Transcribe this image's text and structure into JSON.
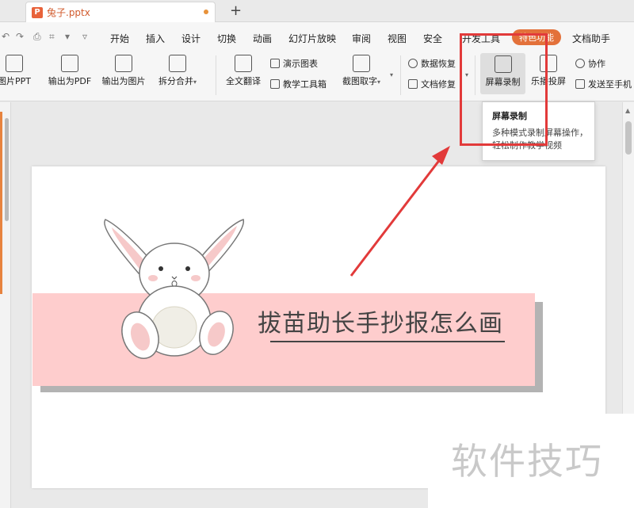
{
  "tab": {
    "icon": "P",
    "title": "兔子.pptx"
  },
  "menu": {
    "items": [
      "开始",
      "插入",
      "设计",
      "切换",
      "动画",
      "幻灯片放映",
      "审阅",
      "视图",
      "安全",
      "开发工具"
    ],
    "special": "特色功能",
    "docs": "文档助手"
  },
  "ribbon": {
    "img_ppt": "图片PPT",
    "pdf": "输出为PDF",
    "img_out": "输出为图片",
    "split": "拆分合并",
    "translate": "全文翻译",
    "demo_chart": "演示图表",
    "teach_tools": "教学工具箱",
    "screenshot_text": "截图取字",
    "data_recovery": "数据恢复",
    "doc_repair": "文档修复",
    "screen_record": "屏幕录制",
    "cast": "乐播投屏",
    "collab": "协作",
    "send_phone": "发送至手机"
  },
  "tooltip": {
    "title": "屏幕录制",
    "desc": "多种模式录制屏幕操作，轻松制作教学视频"
  },
  "slide": {
    "title": "拔苗助长手抄报怎么画"
  },
  "watermark": "软件技巧",
  "colors": {
    "accent": "#e3713a",
    "annotation": "#e23a3a",
    "banner": "#fecdcd"
  }
}
